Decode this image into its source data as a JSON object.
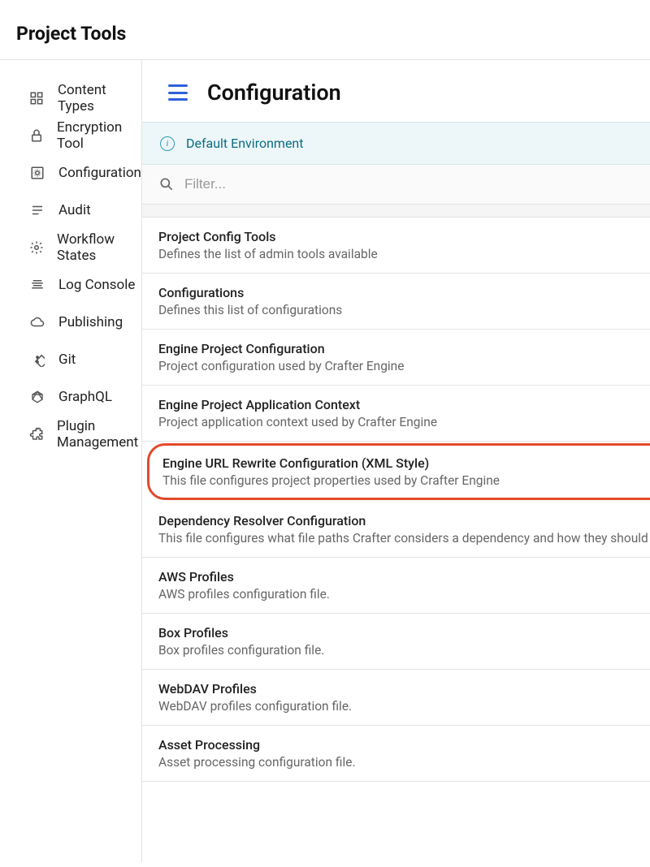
{
  "header": {
    "title": "Project Tools"
  },
  "sidebar": {
    "items": [
      {
        "label": "Content Types",
        "icon": "grid-icon"
      },
      {
        "label": "Encryption Tool",
        "icon": "lock-icon"
      },
      {
        "label": "Configuration",
        "icon": "gear-box-icon"
      },
      {
        "label": "Audit",
        "icon": "list-icon"
      },
      {
        "label": "Workflow States",
        "icon": "gear-icon"
      },
      {
        "label": "Log Console",
        "icon": "lines-icon"
      },
      {
        "label": "Publishing",
        "icon": "cloud-icon"
      },
      {
        "label": "Git",
        "icon": "diamond-icon"
      },
      {
        "label": "GraphQL",
        "icon": "graphql-icon"
      },
      {
        "label": "Plugin Management",
        "icon": "puzzle-icon"
      }
    ]
  },
  "main": {
    "title": "Configuration",
    "env_banner": "Default Environment",
    "filter_placeholder": "Filter...",
    "configs": [
      {
        "title": "Project Config Tools",
        "desc": "Defines the list of admin tools available",
        "highlight": false
      },
      {
        "title": "Configurations",
        "desc": "Defines this list of configurations",
        "highlight": false
      },
      {
        "title": "Engine Project Configuration",
        "desc": "Project configuration used by Crafter Engine",
        "highlight": false
      },
      {
        "title": "Engine Project Application Context",
        "desc": "Project application context used by Crafter Engine",
        "highlight": false
      },
      {
        "title": "Engine URL Rewrite Configuration (XML Style)",
        "desc": "This file configures project properties used by Crafter Engine",
        "highlight": true
      },
      {
        "title": "Dependency Resolver Configuration",
        "desc": "This file configures what file paths Crafter considers a dependency and how they should be resolved",
        "highlight": false
      },
      {
        "title": "AWS Profiles",
        "desc": "AWS profiles configuration file.",
        "highlight": false
      },
      {
        "title": "Box Profiles",
        "desc": "Box profiles configuration file.",
        "highlight": false
      },
      {
        "title": "WebDAV Profiles",
        "desc": "WebDAV profiles configuration file.",
        "highlight": false
      },
      {
        "title": "Asset Processing",
        "desc": "Asset processing configuration file.",
        "highlight": false
      }
    ]
  }
}
